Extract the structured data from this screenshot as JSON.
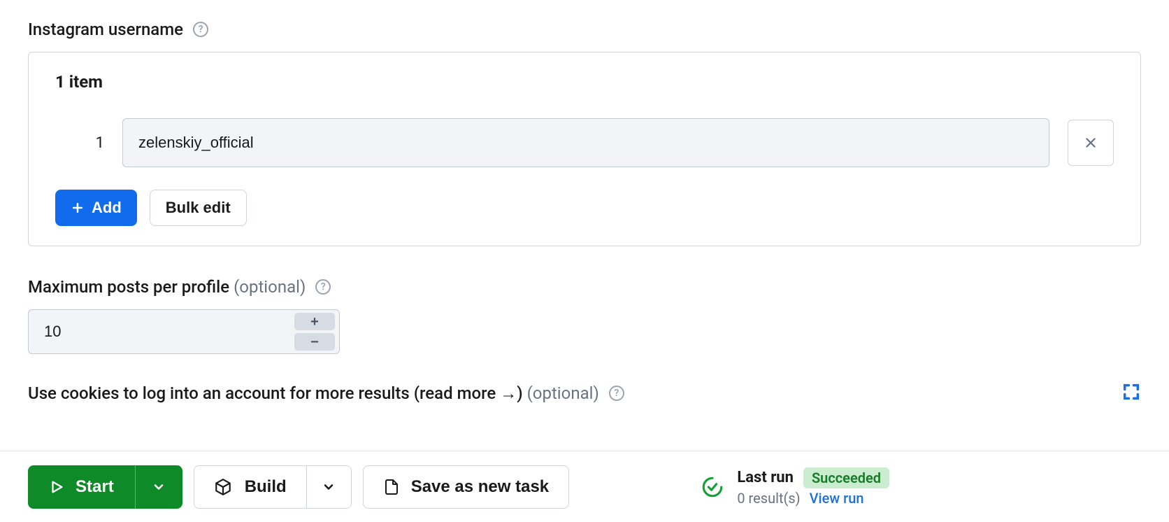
{
  "username_field": {
    "label": "Instagram username",
    "item_count_label": "1 item",
    "items": [
      {
        "index": "1",
        "value": "zelenskiy_official"
      }
    ],
    "add_label": "Add",
    "bulk_label": "Bulk edit"
  },
  "max_posts": {
    "label": "Maximum posts per profile",
    "optional": "(optional)",
    "value": "10"
  },
  "cookies": {
    "label": "Use cookies to log into an account for more results (read more →)",
    "optional": "(optional)"
  },
  "footer": {
    "start": "Start",
    "build": "Build",
    "save": "Save as new task",
    "last_run_label": "Last run",
    "status_badge": "Succeeded",
    "results": "0 result(s)",
    "view": "View run"
  }
}
